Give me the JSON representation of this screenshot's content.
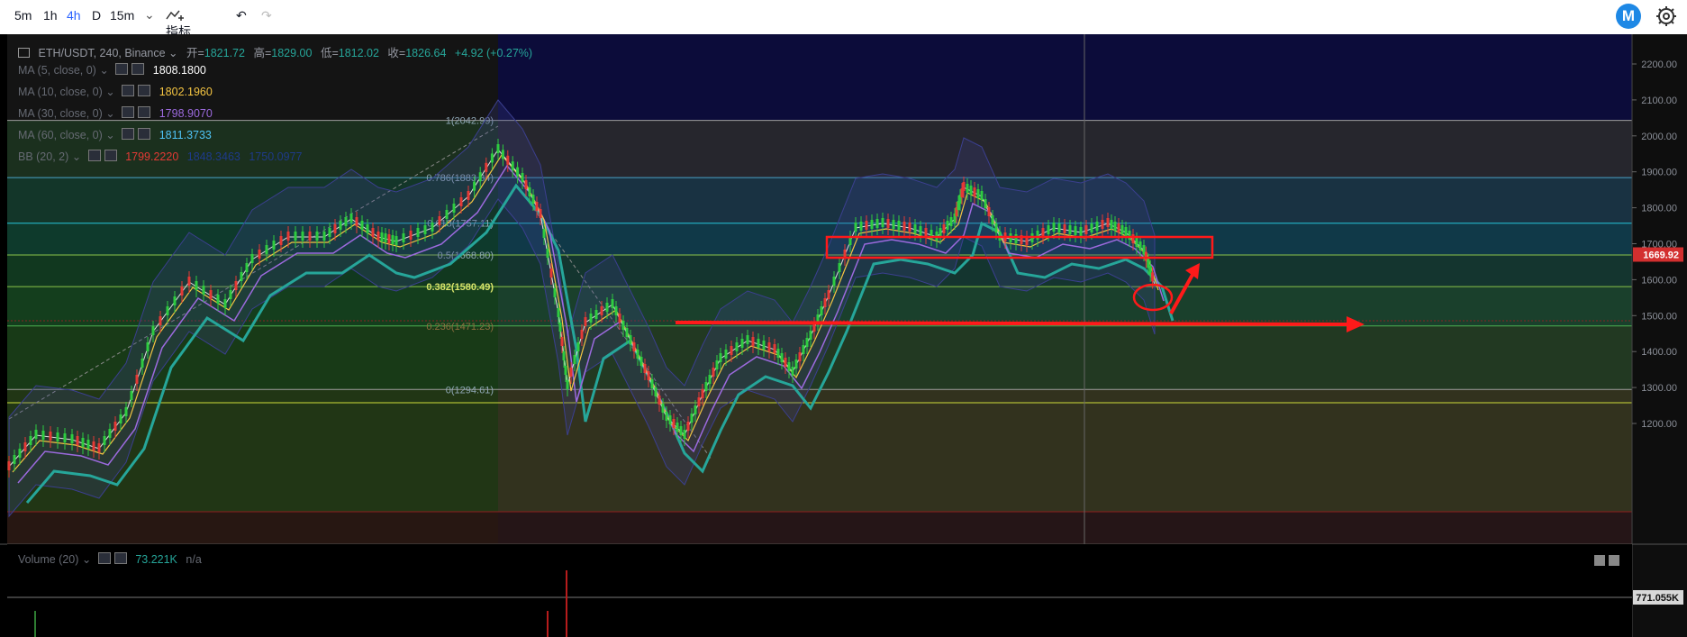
{
  "toolbar": {
    "intervals": [
      "5m",
      "1h",
      "4h",
      "D",
      "15m"
    ],
    "active_interval": "4h",
    "indicators_label": "指标",
    "logo_letter": "M"
  },
  "header": {
    "symbol": "ETH/USDT, 240, Binance",
    "open_label": "开=",
    "open": "1821.72",
    "high_label": "高=",
    "high": "1829.00",
    "low_label": "低=",
    "low": "1812.02",
    "close_label": "收=",
    "close": "1826.64",
    "change": "+4.92 (+0.27%)"
  },
  "indicators": [
    {
      "name": "MA (5, close, 0)",
      "value": "1808.1800",
      "color": "#ffffff"
    },
    {
      "name": "MA (10, close, 0)",
      "value": "1802.1960",
      "color": "#f5c542"
    },
    {
      "name": "MA (30, close, 0)",
      "value": "1798.9070",
      "color": "#9c6ade"
    },
    {
      "name": "MA (60, close, 0)",
      "value": "1811.3733",
      "color": "#4fc3f7"
    },
    {
      "name": "BB (20, 2)",
      "value": "1799.2220",
      "value2": "1848.3463",
      "value3": "1750.0977",
      "color": "#e53935"
    }
  ],
  "fib_levels": [
    {
      "label": "1(2042.99)",
      "price": 2042.99
    },
    {
      "label": "0.786(1883.84)",
      "price": 1883.84
    },
    {
      "label": "0.618(1757.11)",
      "price": 1757.11
    },
    {
      "label": "0.5(1668.80)",
      "price": 1668.8
    },
    {
      "label": "0.382(1580.49)",
      "price": 1580.49
    },
    {
      "label": "0.236(1471.23)",
      "price": 1471.23
    },
    {
      "label": "0(1294.61)",
      "price": 1294.61
    }
  ],
  "price_axis": [
    "2200.00",
    "2100.00",
    "2000.00",
    "1900.00",
    "1800.00",
    "1700.00",
    "1600.00",
    "1500.00",
    "1400.00",
    "1300.00",
    "1200.00"
  ],
  "current_price": "1669.92",
  "volume": {
    "name": "Volume (20)",
    "value": "73.221K",
    "na": "n/a",
    "axis_label": "771.055K"
  },
  "colors": {
    "up": "#26a69a",
    "down": "#ef5350",
    "annotation": "#ff1a1a"
  }
}
